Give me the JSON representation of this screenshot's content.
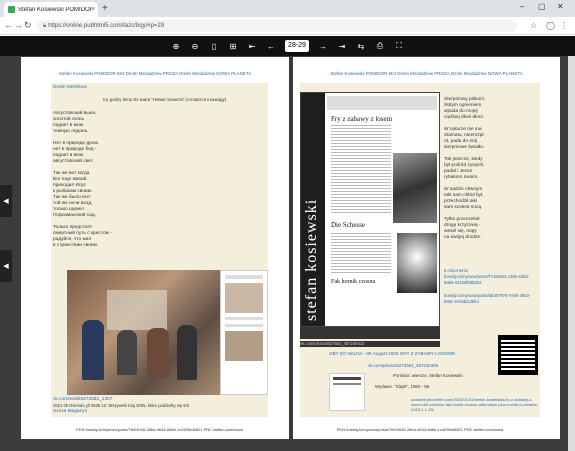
{
  "browser": {
    "tab_title": "Stefan Kosiewski POMIDOR M",
    "url": "https://online.pubhtml5.com/tazc/bqy/#p=29",
    "new_tab": "+",
    "close": "×",
    "back": "←",
    "forward": "→",
    "reload": "↻"
  },
  "viewer": {
    "page_number": "28-29",
    "tools": [
      "⊕",
      "⊖",
      "▯",
      "⊞",
      "⇤",
      "←",
      "→",
      "⇥",
      "⇆",
      "⎙",
      "⛶"
    ]
  },
  "left_page": {
    "header": "Stefan Kosiewski POMIDOR M/4 Dmitri Mindadzew PROZA Dmitri Mindadzew NOWA PLANETA",
    "author": "Dmitri Melnikow",
    "epigraph": "Icy godny temu  Из книги \"Новая планета\" (готовится к выходу)",
    "poem": [
      "Августовский вьюн,",
      "золотой огонь",
      "падает в мою",
      "темную ладонь.",
      "",
      "Нет в природе дрож,",
      "нет в природе бед -",
      "падает в мою",
      "августовский свет.",
      "",
      "Так же вот когда",
      "Бог еще живой,",
      "приходил Исус",
      "к рыбакам своим.",
      "Так же было все:",
      "той же ночи вход,",
      "только шумел",
      "Гефсиманский сад.",
      "",
      "Только предстоят",
      "смертный путь с крестом -",
      "радуйся, что жил",
      "в странствии своем."
    ],
    "photo_caption_link": "vk.com/wall48272552_1407",
    "photo_caption": "2021 05 Dziendo yll 0505 12: Wszyweki toiq 2005, które podzielky się 5/3",
    "photo_caption2": "Szova Magazyn",
    "footer": "PKN bossily.tz/mysova/posts/7fe04045-28bd-4644-8d6b-1c4f29bd6821 PNC twitter.com/sowa"
  },
  "right_page": {
    "header": "Stefan Kosiewski POMIDOR M/4 Dmitri Mindadzew PROZA Dmitri Mindadzew NOWA PLANETA",
    "cover_title": "stefan kosiewski",
    "cover_lines": [
      "Fry z zabawy z losem",
      "Die Schesse",
      "Fak hornik czosnu"
    ],
    "poem": [
      "Sterpniowy piskorz,",
      "złotym ognieniem",
      "wpada do mojej",
      "ciężkiej dłoni dłoni.",
      "",
      "W naturze nie ma",
      "dramatu, niezrozpl-",
      "ot, pada do mój",
      "sierpniowe światło.",
      "",
      "Tak jeszcze, kiedy",
      "był pośród żywych,",
      "padał i Jezus",
      "rybakom swoim.",
      "",
      "W sadzie oliwnym",
      "taki sam chłód był,",
      "przechodził taki",
      "sam szelest nocą.",
      "",
      "Tylko przeczekał",
      "drogę krzyżową -",
      "wesel się, mąty",
      "na swojej drodze."
    ],
    "links": [
      "5 minut temu",
      "bossily.io/mysova/posts/f7d34843-1380-4ddd-8ab5-04425fb8b822",
      "bossily.io/mysova/posts/a6307979-7e0b-4953-b66c-9-b0ddc2bfel",
      "vk.com/photo4827552_457240412"
    ],
    "oby_line": "OBY DO WILNA - 05 August 2025 GRY Z ZABAWY LOSOWE",
    "vk_link": "vk.com/photo48272552_457240495",
    "pomidor": "Pomidor: wiersze.  Stefan Kosiewski",
    "wydawn": "Wydawn. \"Śląsk\", 1983 - 59",
    "sowa_link": "sowarbe.jimdofree.com/2023/01/31/stefan-kosiewski-fry-z-zabawy-z-losem-die-schesse-fak-hornik-czosnu-alternative-plus-rochik-vi-ostrana-2023-1-1-25/",
    "footer": "PKN bossily.tz/mysova/posts/7fe04045-28bd-4644-8d6b-1c4f29bd6821 PNC twitter.com/sowa"
  },
  "side_buttons": [
    "◀",
    "◀"
  ]
}
